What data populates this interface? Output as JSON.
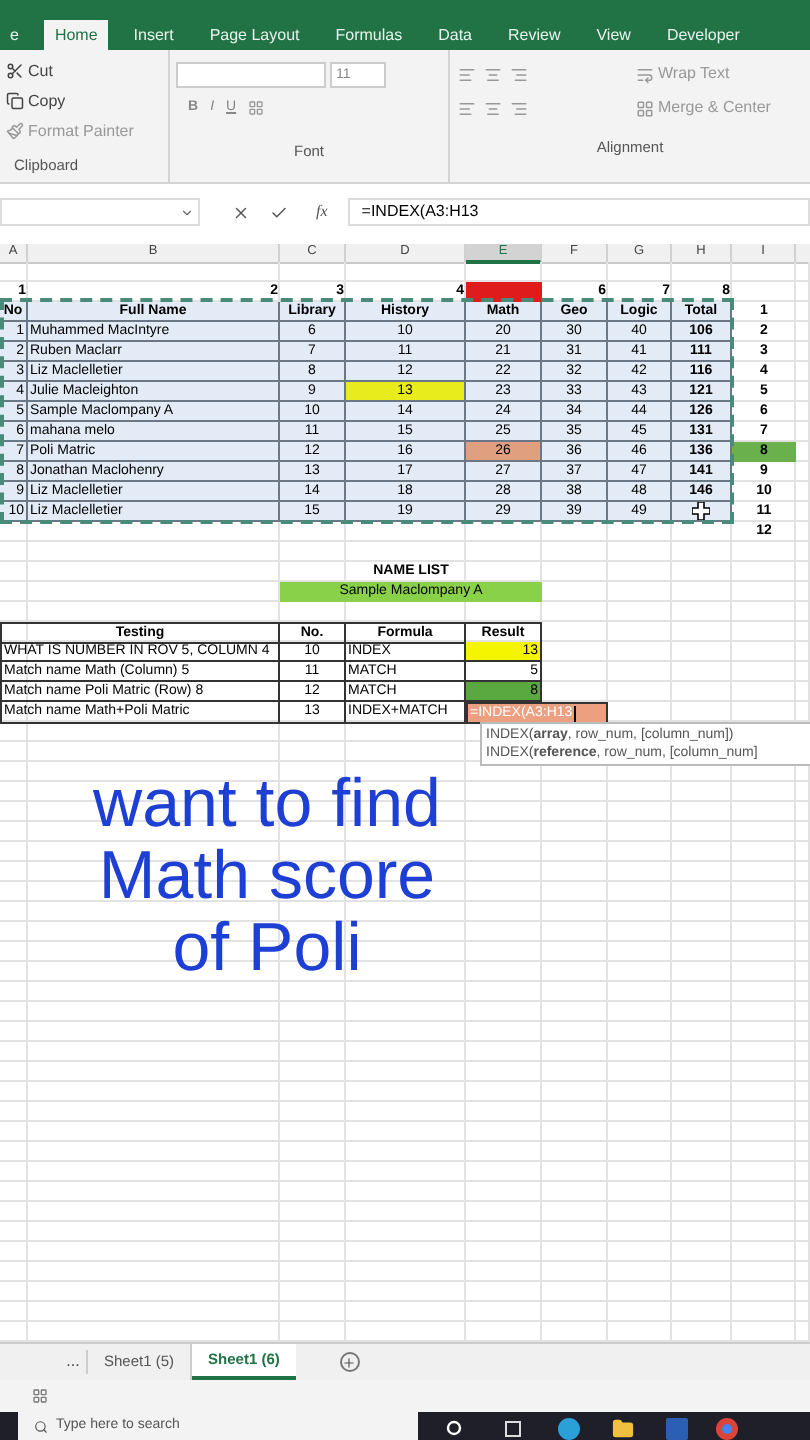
{
  "ribbon_tabs": [
    {
      "label": "e",
      "selected": false
    },
    {
      "label": "Home",
      "selected": true
    },
    {
      "label": "Insert",
      "selected": false
    },
    {
      "label": "Page Layout",
      "selected": false
    },
    {
      "label": "Formulas",
      "selected": false
    },
    {
      "label": "Data",
      "selected": false
    },
    {
      "label": "Review",
      "selected": false
    },
    {
      "label": "View",
      "selected": false
    },
    {
      "label": "Developer",
      "selected": false
    }
  ],
  "clipboard": {
    "cut": "Cut",
    "copy": "Copy",
    "format_painter": "Format Painter",
    "label": "Clipboard"
  },
  "font": {
    "size": "11",
    "bold": "B",
    "italic": "I",
    "underline": "U",
    "label": "Font"
  },
  "alignment": {
    "wrap_text": "Wrap Text",
    "merge": "Merge & Center",
    "label": "Alignment"
  },
  "formula_bar": {
    "fx": "fx",
    "formula": "=INDEX(A3:H13"
  },
  "columns": [
    {
      "label": "A",
      "selected": false
    },
    {
      "label": "B",
      "selected": false
    },
    {
      "label": "C",
      "selected": false
    },
    {
      "label": "D",
      "selected": false
    },
    {
      "label": "E",
      "selected": true
    },
    {
      "label": "F",
      "selected": false
    },
    {
      "label": "G",
      "selected": false
    },
    {
      "label": "H",
      "selected": false
    },
    {
      "label": "I",
      "selected": false
    }
  ],
  "index_row": [
    {
      "text": "1"
    },
    {
      "text": "2"
    },
    {
      "text": "3"
    },
    {
      "text": "4"
    },
    {
      "color": "#e01b1b"
    },
    {
      "text": "6"
    },
    {
      "text": "7"
    },
    {
      "text": "8"
    }
  ],
  "scores": {
    "columns": [
      "No",
      "Full Name",
      "Library",
      "History",
      "Math",
      "Geo",
      "Logic",
      "Total"
    ],
    "rows": [
      [
        "1",
        "Muhammed  MacIntyre",
        "6",
        "10",
        "20",
        "30",
        "40",
        "106"
      ],
      [
        "2",
        "Ruben  Maclarr",
        "7",
        "11",
        "21",
        "31",
        "41",
        "111"
      ],
      [
        "3",
        "Liz  Maclelletier",
        "8",
        "12",
        "22",
        "32",
        "42",
        "116"
      ],
      [
        "4",
        "Julie  Macleighton",
        "9",
        {
          "kind": "highlight",
          "text": "13",
          "color": "#e8ec1c"
        },
        "23",
        "33",
        "43",
        "121"
      ],
      [
        "5",
        "Sample  Maclompany A",
        "10",
        "14",
        "24",
        "34",
        "44",
        "126"
      ],
      [
        "6",
        "mahana melo",
        "11",
        "15",
        "25",
        "35",
        "45",
        "131"
      ],
      [
        "7",
        "Poli Matric",
        "12",
        "16",
        {
          "kind": "highlight",
          "text": "26",
          "color": "#e0a080"
        },
        "36",
        "46",
        "136"
      ],
      [
        "8",
        "Jonathan  Maclohenry",
        "13",
        "17",
        "27",
        "37",
        "47",
        "141"
      ],
      [
        "9",
        "Liz  Maclelletier",
        "14",
        "18",
        "28",
        "38",
        "48",
        "146"
      ],
      [
        "10",
        "Liz  Maclelletier",
        "15",
        "19",
        "29",
        "39",
        "49",
        {
          "kind": "cursor"
        }
      ]
    ]
  },
  "row_numbers": [
    {
      "text": "1"
    },
    {
      "text": "2"
    },
    {
      "text": "3"
    },
    {
      "text": "4"
    },
    {
      "text": "5"
    },
    {
      "text": "6"
    },
    {
      "text": "7"
    },
    {
      "text": "8",
      "color": "#6ab04c"
    },
    {
      "text": "9"
    },
    {
      "text": "10"
    },
    {
      "text": "11"
    },
    {
      "text": "12"
    }
  ],
  "name_list": {
    "title": "NAME LIST",
    "value": "Sample  Maclompany A"
  },
  "testing": {
    "columns": [
      "Testing",
      "No.",
      "Formula",
      "Result"
    ],
    "rows": [
      [
        "WHAT IS NUMBER IN ROV 5, COLUMN 4",
        "10",
        "INDEX",
        {
          "kind": "highlight",
          "text": "13",
          "color": "#f5f500"
        }
      ],
      [
        "Match name Math (Column) 5",
        "11",
        "MATCH",
        "5"
      ],
      [
        "Match name Poli Matric (Row) 8",
        "12",
        "MATCH",
        {
          "kind": "highlight",
          "text": "8",
          "color": "#5aa840"
        }
      ],
      [
        "Match name Math+Poli Matric",
        "13",
        "INDEX+MATCH",
        {
          "kind": "editing",
          "text": "=INDEX(A3:H13",
          "color": "#eda080"
        }
      ]
    ]
  },
  "tooltip": [
    "INDEX(**array**, row_num, [column_num])",
    "INDEX(**reference**, row_num, [column_num]"
  ],
  "caption": "want to find Math score of Poli",
  "more_sheets": "...",
  "sheet_tabs": [
    {
      "label": "Sheet1 (5)",
      "selected": false
    },
    {
      "label": "Sheet1 (6)",
      "selected": true
    }
  ],
  "taskbar": {
    "search_placeholder": "Type here to search"
  }
}
